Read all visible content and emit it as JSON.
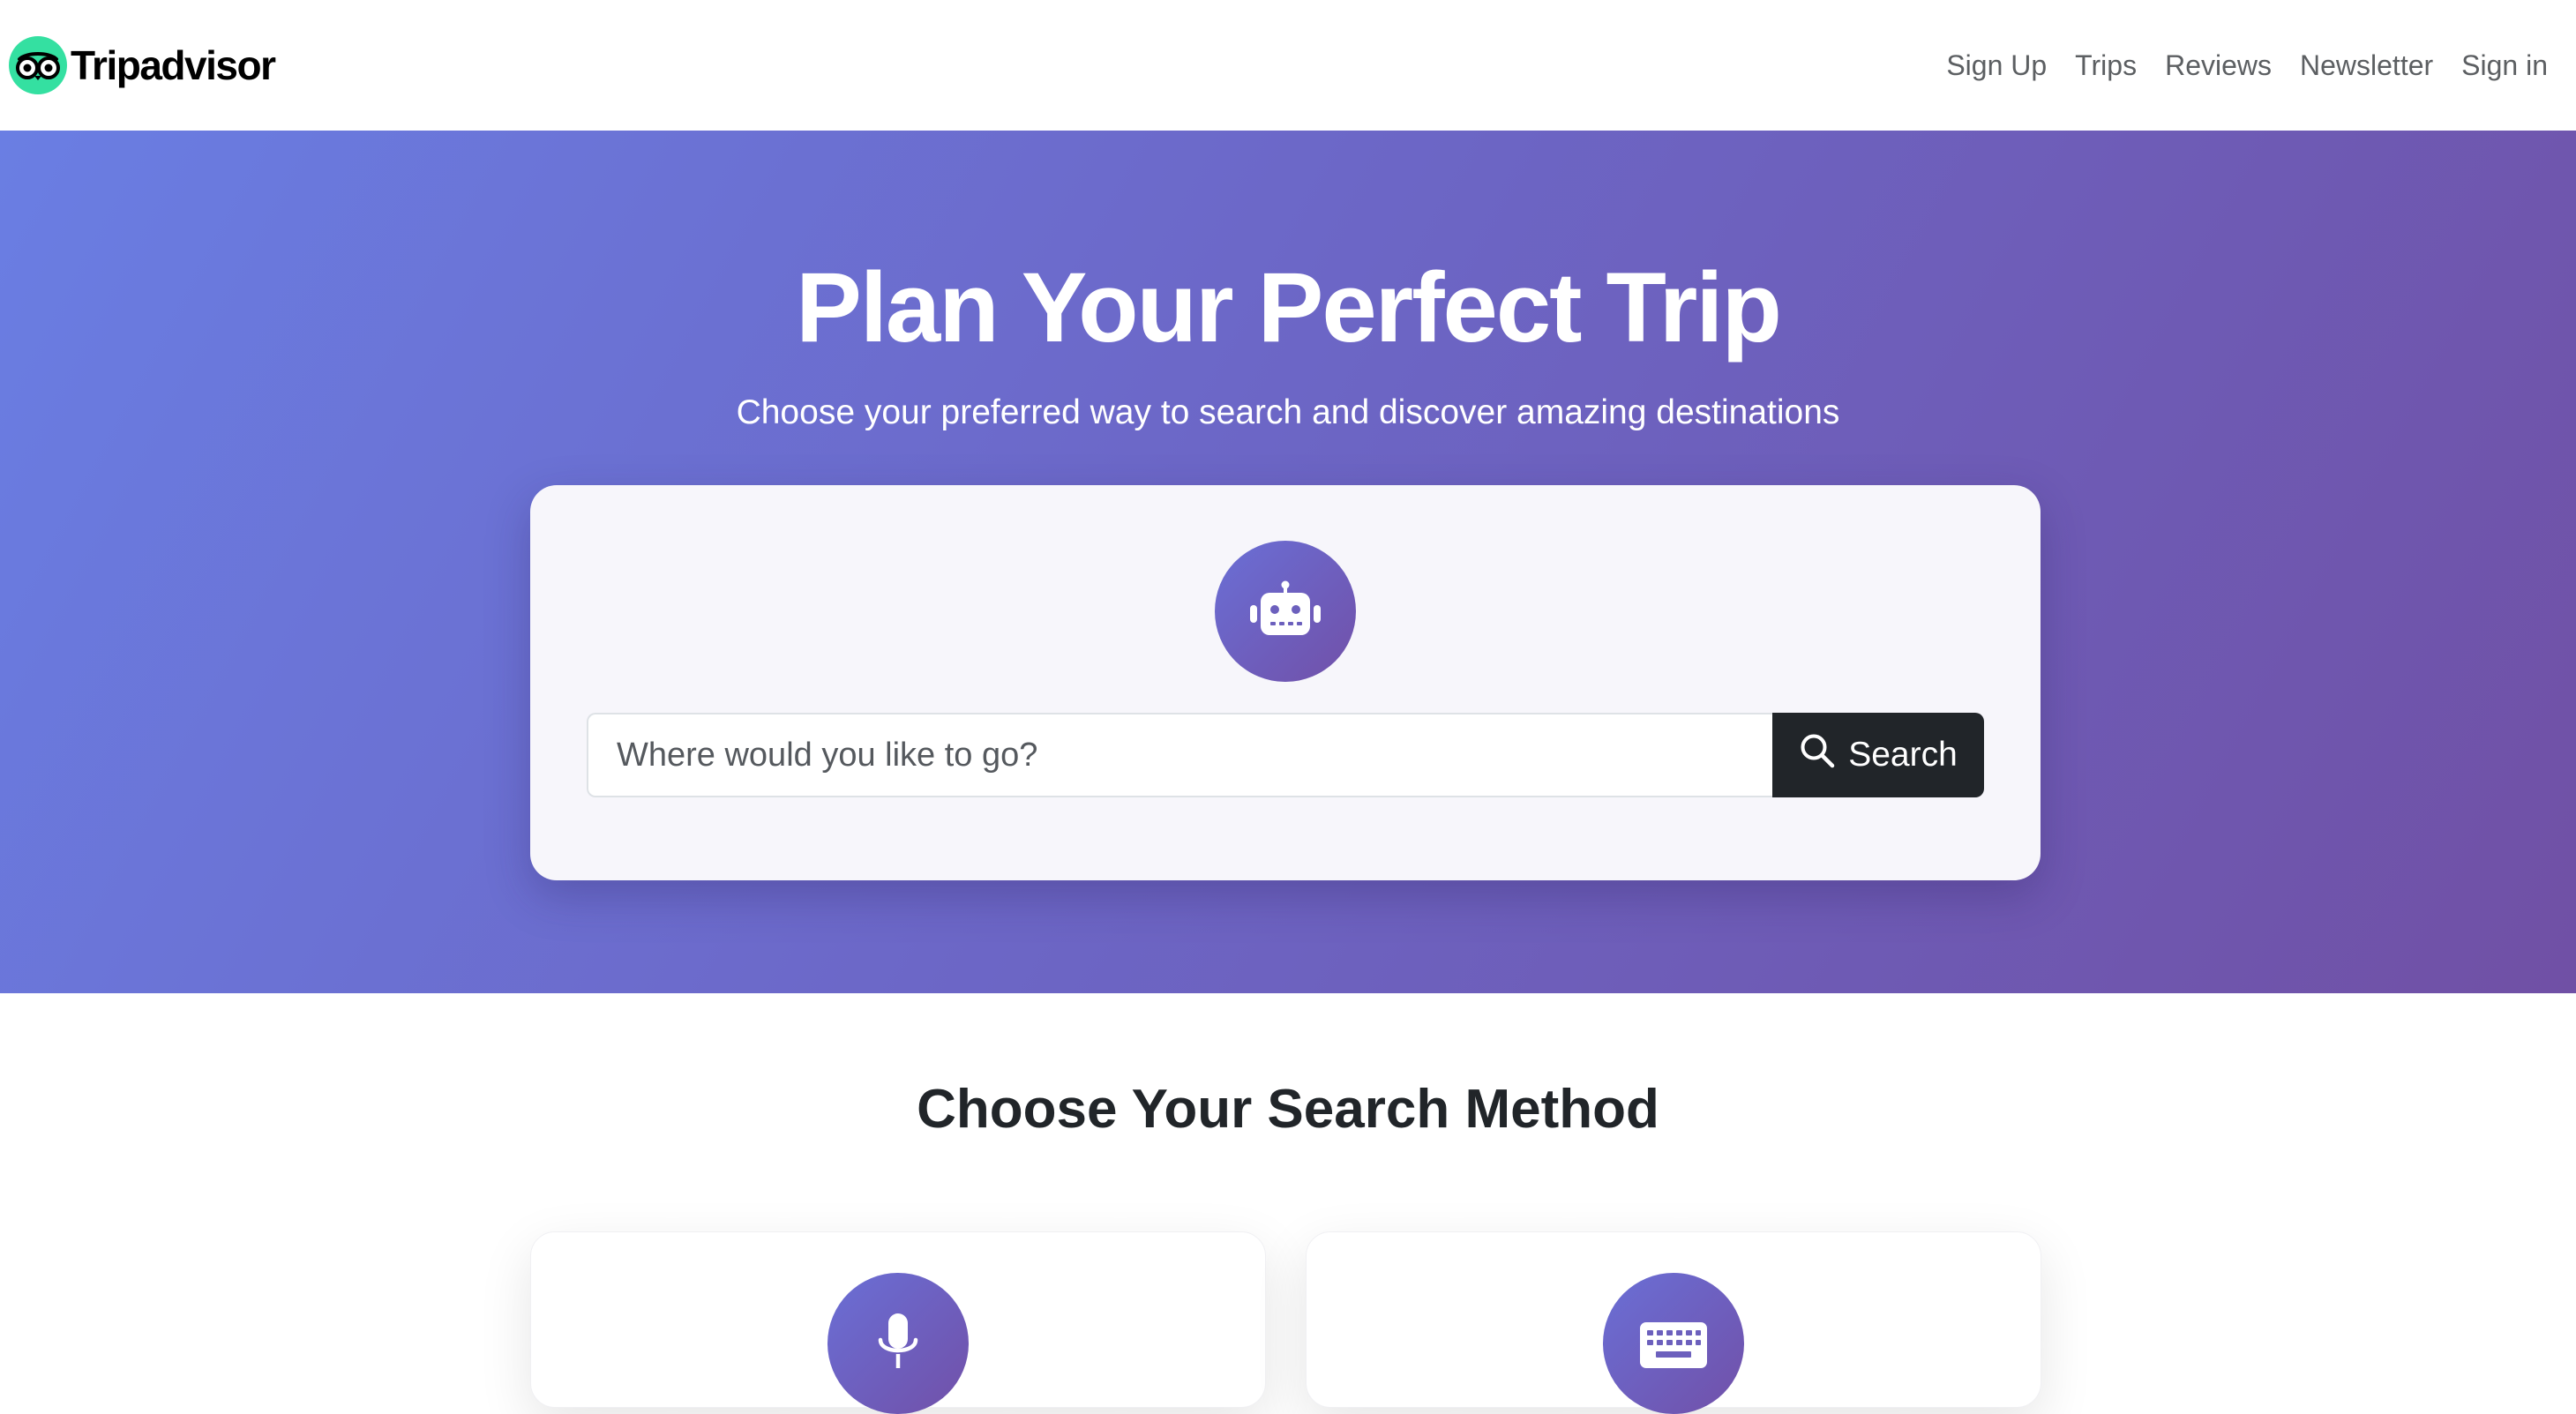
{
  "brand": {
    "name": "Tripadvisor",
    "logo_icon": "tripadvisor-owl-icon",
    "logo_color": "#34e0a1"
  },
  "nav": {
    "links": [
      "Sign Up",
      "Trips",
      "Reviews",
      "Newsletter",
      "Sign in"
    ]
  },
  "hero": {
    "title": "Plan Your Perfect Trip",
    "subtitle": "Choose your preferred way to search and discover amazing destinations",
    "gradient": [
      "#6a7ee3",
      "#7050a5"
    ],
    "badge_icon": "robot-icon",
    "search": {
      "placeholder": "Where would you like to go?",
      "value": "",
      "button_label": "Search",
      "button_icon": "search-icon",
      "button_color": "#212529"
    }
  },
  "methods": {
    "title": "Choose Your Search Method",
    "cards": [
      {
        "icon": "microphone-icon"
      },
      {
        "icon": "keyboard-icon"
      }
    ]
  }
}
